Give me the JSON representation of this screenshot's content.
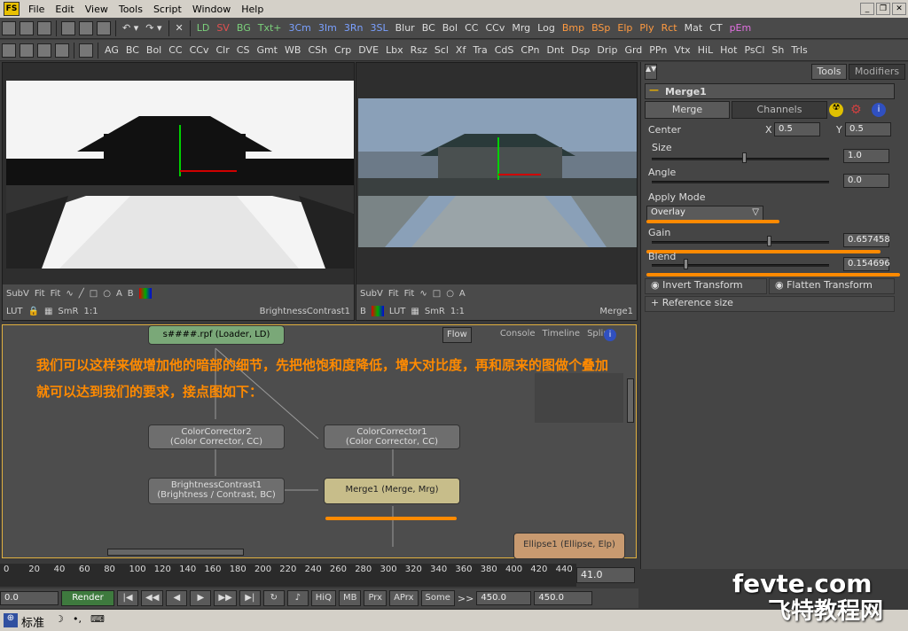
{
  "menu": {
    "logo": "FS",
    "items": [
      "File",
      "Edit",
      "View",
      "Tools",
      "Script",
      "Window",
      "Help"
    ]
  },
  "toolbar1": [
    "LD",
    "SV",
    "BG",
    "Txt+",
    "3Cm",
    "3Im",
    "3Rn",
    "3SL",
    "Blur",
    "BC",
    "Bol",
    "CC",
    "CCv",
    "Mrg",
    "Log",
    "Bmp",
    "BSp",
    "Elp",
    "Ply",
    "Rct",
    "Mat",
    "CT",
    "pEm"
  ],
  "toolbar1_colors": {
    "LD": "#7bd07b",
    "SV": "#e05050",
    "BG": "#7bd07b",
    "Txt+": "#7bd07b",
    "3Cm": "#7aa0ff",
    "3Im": "#7aa0ff",
    "3Rn": "#7aa0ff",
    "3SL": "#7aa0ff",
    "Bmp": "#ff9a40",
    "BSp": "#ff9a40",
    "Elp": "#ff9a40",
    "Ply": "#ff9a40",
    "Rct": "#ff9a40",
    "pEm": "#e070e0"
  },
  "toolbar2": [
    "AG",
    "BC",
    "Bol",
    "CC",
    "CCv",
    "Clr",
    "CS",
    "Gmt",
    "WB",
    "CSh",
    "Crp",
    "DVE",
    "Lbx",
    "Rsz",
    "Scl",
    "Xf",
    "Tra",
    "CdS",
    "CPn",
    "Dnt",
    "Dsp",
    "Drip",
    "Grd",
    "PPn",
    "Vtx",
    "HiL",
    "Hot",
    "PsCl",
    "Sh",
    "Trls"
  ],
  "viewer_left": {
    "bar1": [
      "SubV",
      "Fit",
      "Fit"
    ],
    "bar2": [
      "LUT",
      "SmR",
      "1:1"
    ],
    "label": "BrightnessContrast1",
    "btns": [
      "A",
      "B"
    ]
  },
  "viewer_right": {
    "bar1": [
      "SubV",
      "Fit",
      "Fit"
    ],
    "bar2": [
      "B",
      "LUT",
      "SmR",
      "1:1"
    ],
    "label": "Merge1",
    "btns": [
      "A"
    ]
  },
  "side": {
    "tabs": [
      "Tools",
      "Modifiers"
    ],
    "tool_name": "Merge1",
    "subtabs": [
      "Merge",
      "Channels"
    ],
    "center_label": "Center",
    "x_label": "X",
    "x_val": "0.5",
    "y_label": "Y",
    "y_val": "0.5",
    "size_label": "Size",
    "size_val": "1.0",
    "angle_label": "Angle",
    "angle_val": "0.0",
    "apply_mode_label": "Apply Mode",
    "apply_mode_val": "Overlay",
    "gain_label": "Gain",
    "gain_val": "0.657458",
    "blend_label": "Blend",
    "blend_val": "0.154696",
    "invert_label": "Invert Transform",
    "flatten_label": "Flatten Transform",
    "reference_label": "Reference size"
  },
  "flow": {
    "tabs": [
      "Flow",
      "Console",
      "Timeline",
      "Spline"
    ],
    "text_line1": "我们可以这样来做增加他的暗部的细节，先把他饱和度降低，增大对比度，再和原来的图做个叠加",
    "text_line2": "就可以达到我们的要求，接点图如下：",
    "nodes": {
      "loader": "s####.rpf  (Loader, LD)",
      "cc2_a": "ColorCorrector2",
      "cc2_b": "(Color Corrector, CC)",
      "cc1_a": "ColorCorrector1",
      "cc1_b": "(Color Corrector, CC)",
      "bc_a": "BrightnessContrast1",
      "bc_b": "(Brightness / Contrast, BC)",
      "merge": "Merge1  (Merge, Mrg)",
      "ellipse": "Ellipse1  (Ellipse, Elp)"
    }
  },
  "timeline": {
    "ticks": [
      "0",
      "20",
      "40",
      "60",
      "80",
      "100",
      "120",
      "140",
      "160",
      "180",
      "200",
      "220",
      "240",
      "260",
      "280",
      "300",
      "320",
      "340",
      "360",
      "380",
      "400",
      "420",
      "440"
    ],
    "end_val": "41.0"
  },
  "transport": {
    "start": "0.0",
    "render": "Render",
    "btns": [
      "HiQ",
      "MB",
      "Prx",
      "APrx",
      "Some"
    ],
    "arrow": ">>",
    "v1": "450.0",
    "v2": "450.0"
  },
  "taskbar": {
    "ime": "标准"
  },
  "watermark": {
    "line1": "fevte.com",
    "line2": "飞特教程网"
  }
}
